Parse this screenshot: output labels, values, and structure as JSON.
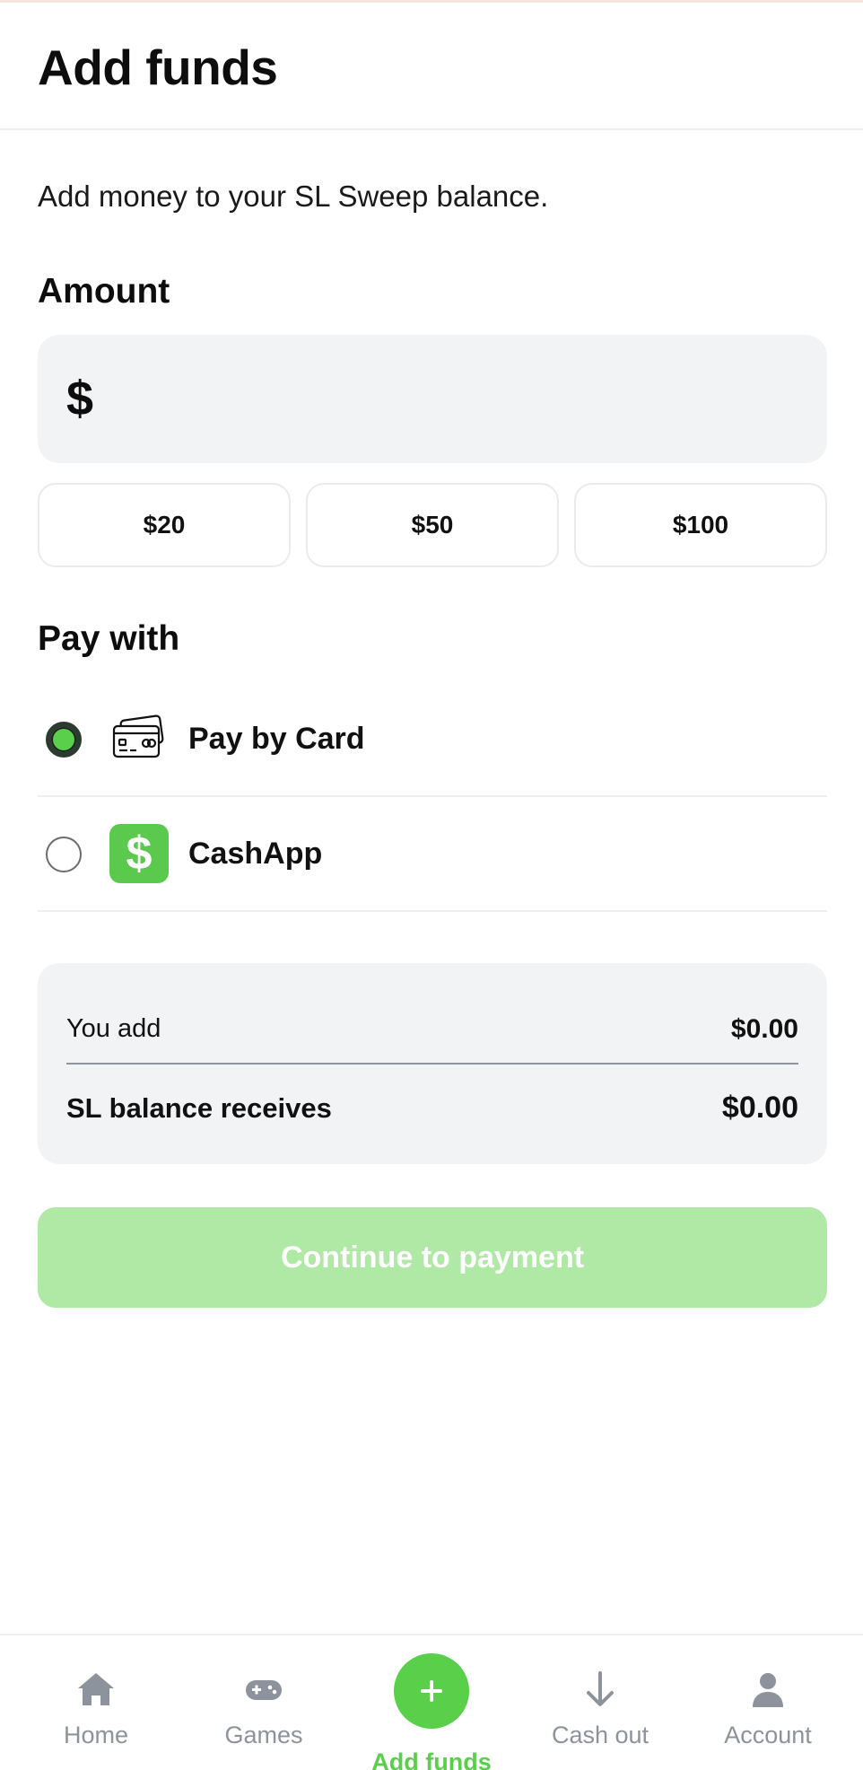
{
  "header": {
    "title": "Add funds"
  },
  "subtitle": "Add money to your SL Sweep balance.",
  "amount": {
    "title": "Amount",
    "currency_symbol": "$",
    "value": "",
    "presets": [
      "$20",
      "$50",
      "$100"
    ]
  },
  "pay_with": {
    "title": "Pay with",
    "options": [
      {
        "label": "Pay by Card",
        "icon": "credit-card-icon",
        "selected": true
      },
      {
        "label": "CashApp",
        "icon": "cashapp-icon",
        "icon_glyph": "$",
        "selected": false
      }
    ]
  },
  "summary": {
    "you_add_label": "You add",
    "you_add_value": "$0.00",
    "receives_label": "SL balance receives",
    "receives_value": "$0.00"
  },
  "cta": {
    "label": "Continue to payment",
    "enabled": false
  },
  "bottom_nav": {
    "items": [
      {
        "label": "Home",
        "icon": "home-icon",
        "active": false
      },
      {
        "label": "Games",
        "icon": "gamepad-icon",
        "active": false
      },
      {
        "label": "Add funds",
        "icon": "plus-icon",
        "active": true
      },
      {
        "label": "Cash out",
        "icon": "arrow-down-icon",
        "active": false
      },
      {
        "label": "Account",
        "icon": "user-icon",
        "active": false
      }
    ]
  },
  "colors": {
    "accent": "#59cf4a",
    "cta_disabled": "#b0e8a6",
    "muted": "#8d939c",
    "field_bg": "#f2f3f4"
  }
}
